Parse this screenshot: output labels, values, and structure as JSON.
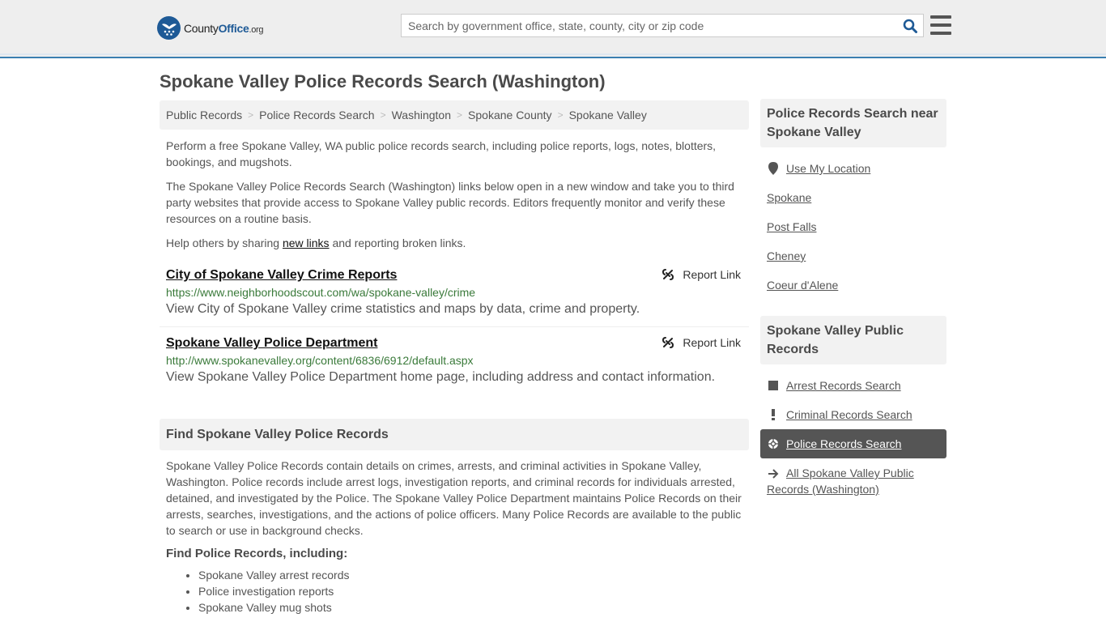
{
  "header": {
    "logo_brand_prefix": "County",
    "logo_brand_main": "Office",
    "logo_brand_suffix": ".org",
    "search_placeholder": "Search by government office, state, county, city or zip code",
    "search_value": ""
  },
  "page": {
    "title": "Spokane Valley Police Records Search (Washington)"
  },
  "breadcrumb": [
    {
      "label": "Public Records"
    },
    {
      "label": "Police Records Search"
    },
    {
      "label": "Washington"
    },
    {
      "label": "Spokane County"
    },
    {
      "label": "Spokane Valley"
    }
  ],
  "intro": {
    "p1": "Perform a free Spokane Valley, WA public police records search, including police reports, logs, notes, blotters, bookings, and mugshots.",
    "p2": "The Spokane Valley Police Records Search (Washington) links below open in a new window and take you to third party websites that provide access to Spokane Valley public records. Editors frequently monitor and verify these resources on a routine basis.",
    "p3_before": "Help others by sharing ",
    "p3_link": "new links",
    "p3_after": " and reporting broken links."
  },
  "listings": [
    {
      "title": "City of Spokane Valley Crime Reports",
      "url": "https://www.neighborhoodscout.com/wa/spokane-valley/crime",
      "description": "View City of Spokane Valley crime statistics and maps by data, crime and property.",
      "report_label": "Report Link"
    },
    {
      "title": "Spokane Valley Police Department",
      "url": "http://www.spokanevalley.org/content/6836/6912/default.aspx",
      "description": "View Spokane Valley Police Department home page, including address and contact information.",
      "report_label": "Report Link"
    }
  ],
  "find_section": {
    "heading": "Find Spokane Valley Police Records",
    "body": "Spokane Valley Police Records contain details on crimes, arrests, and criminal activities in Spokane Valley, Washington. Police records include arrest logs, investigation reports, and criminal records for individuals arrested, detained, and investigated by the Police. The Spokane Valley Police Department maintains Police Records on their arrests, searches, investigations, and the actions of police officers. Many Police Records are available to the public to search or use in background checks.",
    "subheading": "Find Police Records, including:",
    "bullets": [
      "Spokane Valley arrest records",
      "Police investigation reports",
      "Spokane Valley mug shots"
    ]
  },
  "sidebar": {
    "nearby": {
      "heading": "Police Records Search near Spokane Valley",
      "use_location": "Use My Location",
      "cities": [
        "Spokane",
        "Post Falls",
        "Cheney",
        "Coeur d'Alene"
      ]
    },
    "public_records": {
      "heading": "Spokane Valley Public Records",
      "items": [
        {
          "label": "Arrest Records Search",
          "icon": "square-icon",
          "active": false
        },
        {
          "label": "Criminal Records Search",
          "icon": "exclamation-icon",
          "active": false
        },
        {
          "label": "Police Records Search",
          "icon": "crosshair-icon",
          "active": true
        },
        {
          "label": "All Spokane Valley Public Records (Washington)",
          "icon": "arrow-right-icon",
          "active": false
        }
      ]
    }
  },
  "colors": {
    "brand_blue": "#1e5a96",
    "header_border": "#3a7fb0",
    "url_green": "#3a7a3a",
    "active_bg": "#555555"
  }
}
